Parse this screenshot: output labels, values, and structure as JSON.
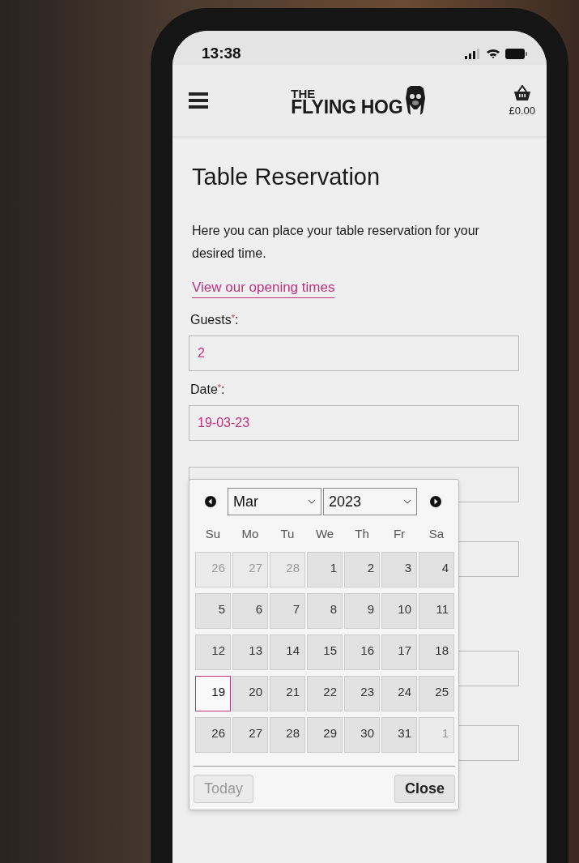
{
  "status_bar": {
    "time": "13:38"
  },
  "header": {
    "logo_top": "THE",
    "logo_bottom": "FLYING HOG",
    "cart_total": "£0.00"
  },
  "page": {
    "title": "Table Reservation",
    "intro": "Here you can place your table reservation for your desired time.",
    "link": "View our opening times"
  },
  "fields": [
    {
      "label": "Guests",
      "required_mark": "*",
      "suffix": ":",
      "value": "2"
    },
    {
      "label": "Date",
      "required_mark": "*",
      "suffix": ":",
      "value": "19-03-23"
    }
  ],
  "datepicker": {
    "month": "Mar",
    "year": "2023",
    "weekdays": [
      "Su",
      "Mo",
      "Tu",
      "We",
      "Th",
      "Fr",
      "Sa"
    ],
    "days": [
      {
        "label": "26",
        "kind": "other",
        "selected": false
      },
      {
        "label": "27",
        "kind": "other",
        "selected": false
      },
      {
        "label": "28",
        "kind": "other",
        "selected": false
      },
      {
        "label": "1",
        "kind": "current",
        "selected": false
      },
      {
        "label": "2",
        "kind": "current",
        "selected": false
      },
      {
        "label": "3",
        "kind": "current",
        "selected": false
      },
      {
        "label": "4",
        "kind": "current",
        "selected": false
      },
      {
        "label": "5",
        "kind": "current",
        "selected": false
      },
      {
        "label": "6",
        "kind": "current",
        "selected": false
      },
      {
        "label": "7",
        "kind": "current",
        "selected": false
      },
      {
        "label": "8",
        "kind": "current",
        "selected": false
      },
      {
        "label": "9",
        "kind": "current",
        "selected": false
      },
      {
        "label": "10",
        "kind": "current",
        "selected": false
      },
      {
        "label": "11",
        "kind": "current",
        "selected": false
      },
      {
        "label": "12",
        "kind": "current",
        "selected": false
      },
      {
        "label": "13",
        "kind": "current",
        "selected": false
      },
      {
        "label": "14",
        "kind": "current",
        "selected": false
      },
      {
        "label": "15",
        "kind": "current",
        "selected": false
      },
      {
        "label": "16",
        "kind": "current",
        "selected": false
      },
      {
        "label": "17",
        "kind": "current",
        "selected": false
      },
      {
        "label": "18",
        "kind": "current",
        "selected": false
      },
      {
        "label": "19",
        "kind": "current",
        "selected": true
      },
      {
        "label": "20",
        "kind": "current",
        "selected": false
      },
      {
        "label": "21",
        "kind": "current",
        "selected": false
      },
      {
        "label": "22",
        "kind": "current",
        "selected": false
      },
      {
        "label": "23",
        "kind": "current",
        "selected": false
      },
      {
        "label": "24",
        "kind": "current",
        "selected": false
      },
      {
        "label": "25",
        "kind": "current",
        "selected": false
      },
      {
        "label": "26",
        "kind": "current",
        "selected": false
      },
      {
        "label": "27",
        "kind": "current",
        "selected": false
      },
      {
        "label": "28",
        "kind": "current",
        "selected": false
      },
      {
        "label": "29",
        "kind": "current",
        "selected": false
      },
      {
        "label": "30",
        "kind": "current",
        "selected": false
      },
      {
        "label": "31",
        "kind": "current",
        "selected": false
      },
      {
        "label": "1",
        "kind": "other",
        "selected": false
      }
    ],
    "today_button": {
      "label": "Today",
      "disabled": true
    },
    "close_button": {
      "label": "Close",
      "disabled": false
    }
  }
}
